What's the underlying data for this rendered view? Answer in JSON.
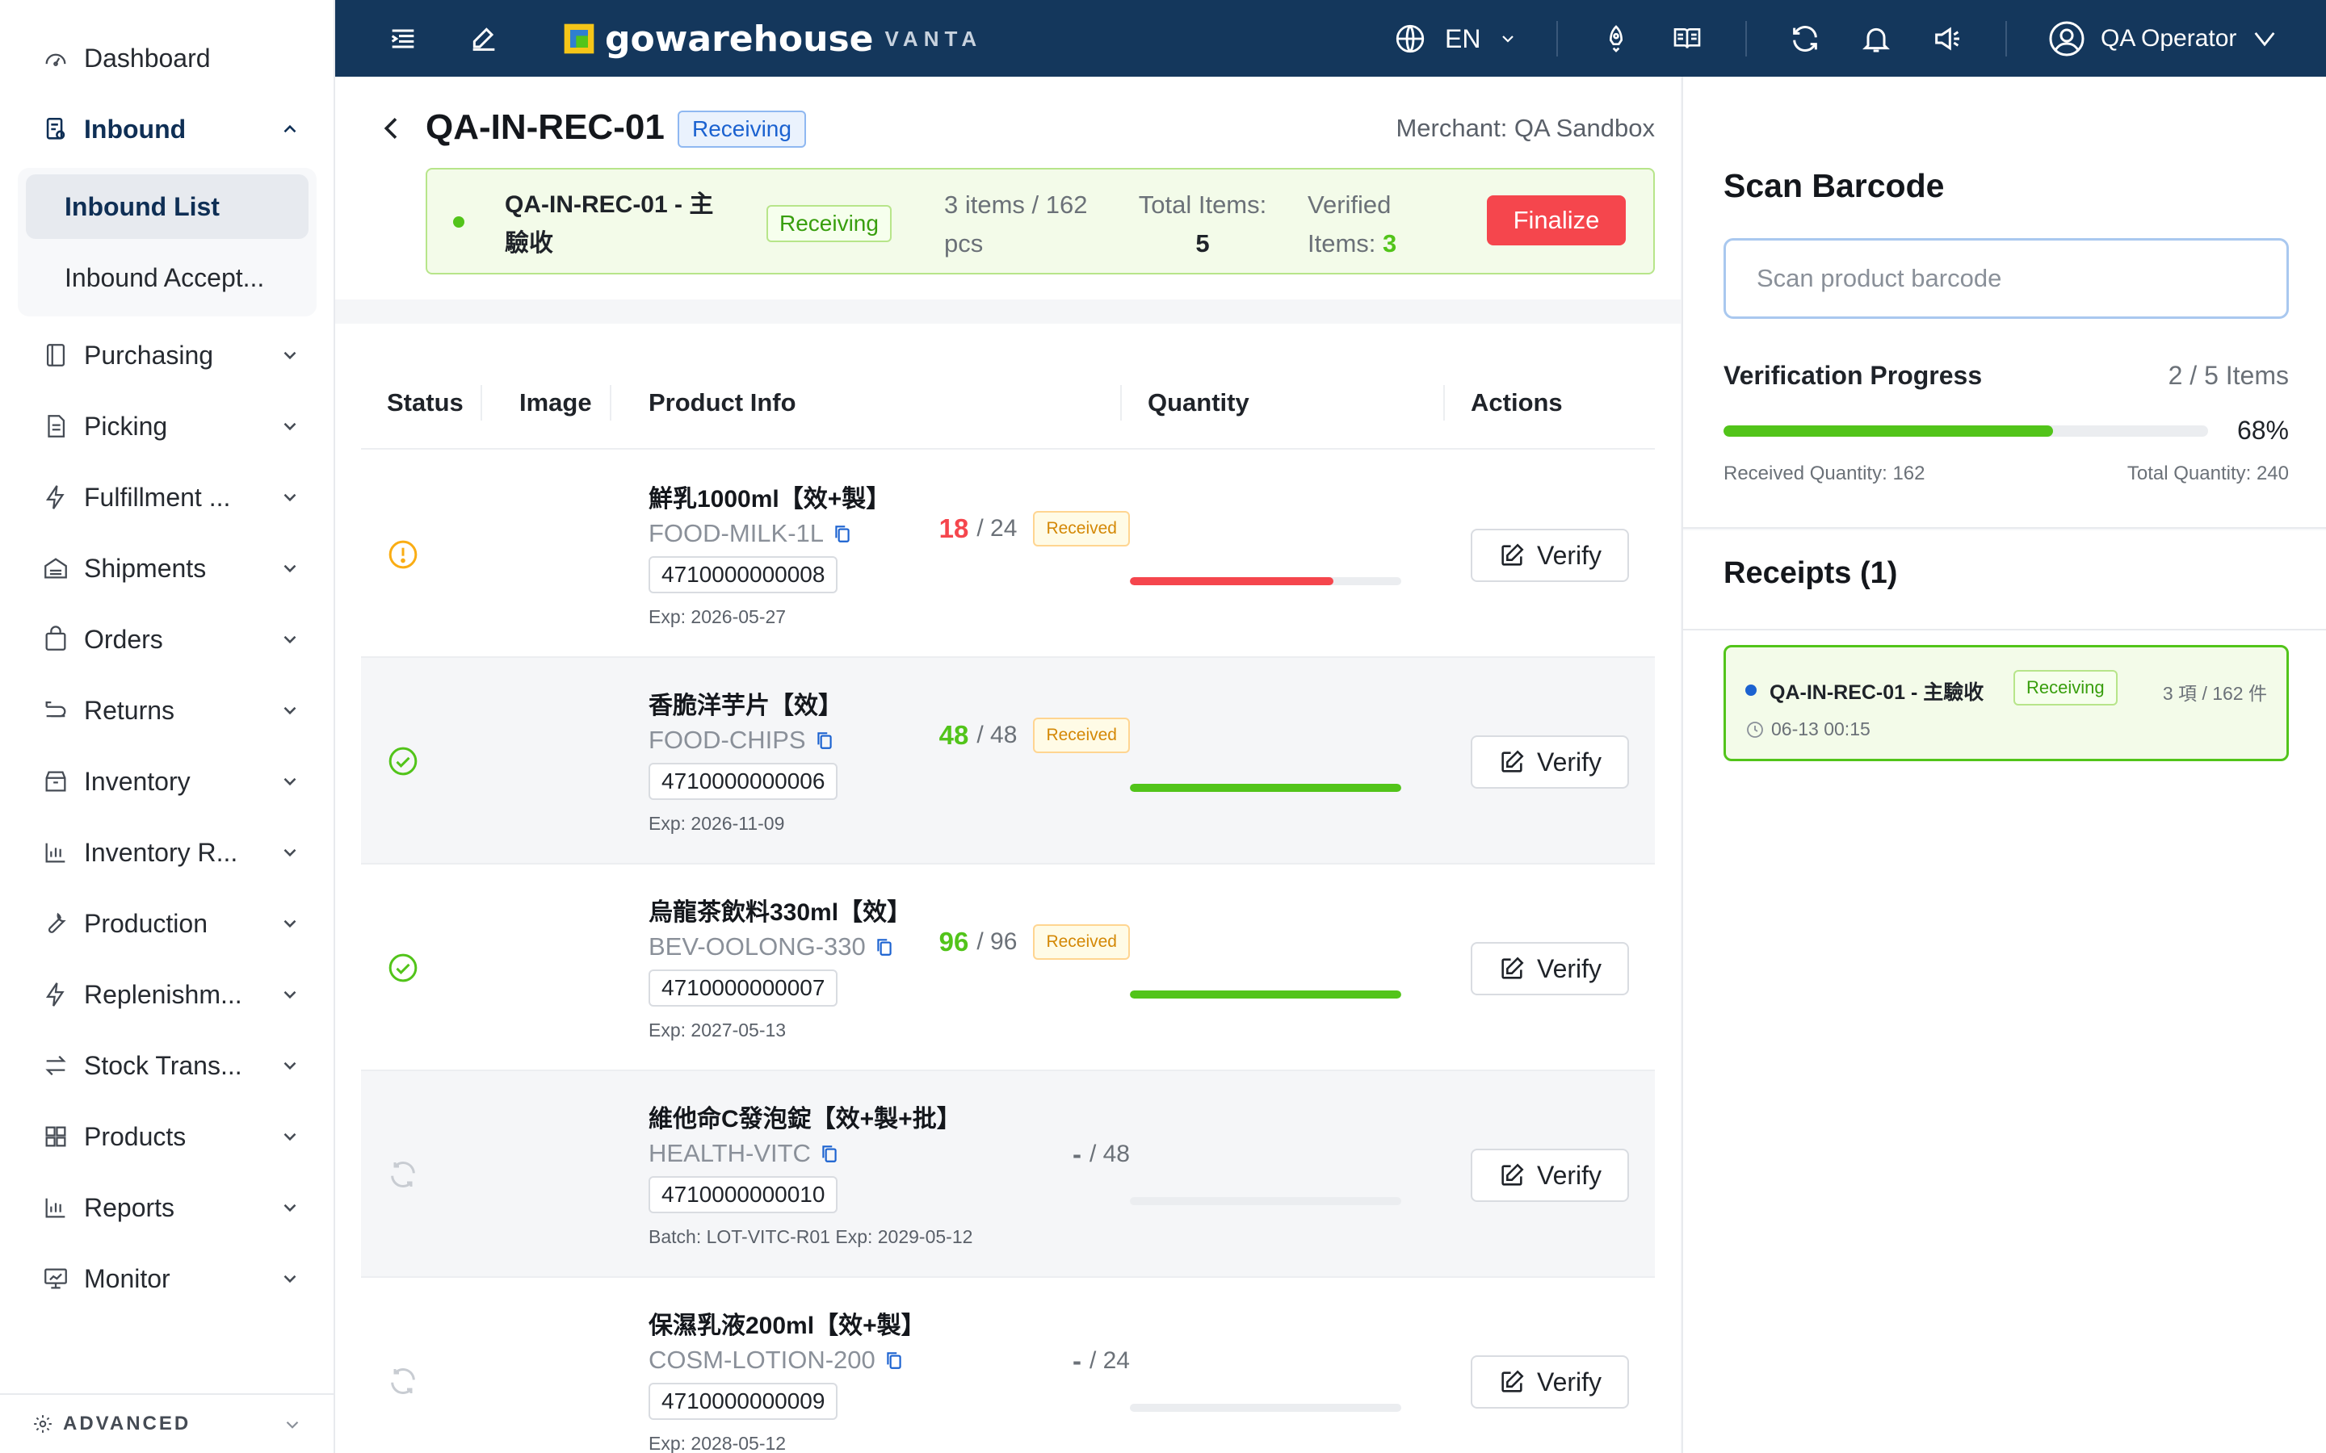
{
  "sidebar": {
    "items": [
      {
        "label": "Dashboard",
        "icon": "dashboard-icon"
      },
      {
        "label": "Inbound",
        "icon": "inbound-icon"
      },
      {
        "label": "Purchasing",
        "icon": "purchasing-icon"
      },
      {
        "label": "Picking",
        "icon": "picking-icon"
      },
      {
        "label": "Fulfillment ...",
        "icon": "fulfillment-icon"
      },
      {
        "label": "Shipments",
        "icon": "shipments-icon"
      },
      {
        "label": "Orders",
        "icon": "orders-icon"
      },
      {
        "label": "Returns",
        "icon": "returns-icon"
      },
      {
        "label": "Inventory",
        "icon": "inventory-icon"
      },
      {
        "label": "Inventory R...",
        "icon": "inventory-report-icon"
      },
      {
        "label": "Production",
        "icon": "production-icon"
      },
      {
        "label": "Replenishm...",
        "icon": "replenishment-icon"
      },
      {
        "label": "Stock Trans...",
        "icon": "stock-transfer-icon"
      },
      {
        "label": "Products",
        "icon": "products-icon"
      },
      {
        "label": "Reports",
        "icon": "reports-icon"
      },
      {
        "label": "Monitor",
        "icon": "monitor-icon"
      }
    ],
    "inbound_sub": {
      "list": "Inbound List",
      "accept": "Inbound Accept..."
    },
    "advanced": "ADVANCED"
  },
  "topbar": {
    "brand": "gowarehouse",
    "brand_suffix": "VANTA",
    "language": "EN",
    "user": "QA Operator"
  },
  "header": {
    "title": "QA-IN-REC-01",
    "status_tag": "Receiving",
    "merchant": "Merchant: QA Sandbox"
  },
  "summary": {
    "name": "QA-IN-REC-01 - 主驗收",
    "tag": "Receiving",
    "count": "3 items / 162 pcs",
    "total_label": "Total Items:",
    "total_value": "5",
    "verified_label": "Verified Items:",
    "verified_value": "3",
    "finalize": "Finalize"
  },
  "table": {
    "headers": {
      "status": "Status",
      "image": "Image",
      "product": "Product Info",
      "quantity": "Quantity",
      "actions": "Actions"
    },
    "received_tag": "Received",
    "verify_label": "Verify",
    "rows": [
      {
        "status": "warning",
        "name": "鮮乳1000ml【效+製】",
        "sku": "FOOD-MILK-1L",
        "barcode": "4710000000008",
        "meta": "Exp: 2026-05-27",
        "received": "18",
        "expected": "/ 24",
        "progress": 0.75,
        "state": "red"
      },
      {
        "status": "ok",
        "name": "香脆洋芋片【效】",
        "sku": "FOOD-CHIPS",
        "barcode": "4710000000006",
        "meta": "Exp: 2026-11-09",
        "received": "48",
        "expected": "/ 48",
        "progress": 1.0,
        "state": "green"
      },
      {
        "status": "ok",
        "name": "烏龍茶飲料330ml【效】",
        "sku": "BEV-OOLONG-330",
        "barcode": "4710000000007",
        "meta": "Exp: 2027-05-13",
        "received": "96",
        "expected": "/ 96",
        "progress": 1.0,
        "state": "green"
      },
      {
        "status": "pending",
        "name": "維他命C發泡錠【效+製+批】",
        "sku": "HEALTH-VITC",
        "barcode": "4710000000010",
        "meta": "Batch: LOT-VITC-R01   Exp: 2029-05-12",
        "received": "-",
        "expected": "/ 48",
        "progress": 0,
        "state": "none"
      },
      {
        "status": "pending",
        "name": "保濕乳液200ml【效+製】",
        "sku": "COSM-LOTION-200",
        "barcode": "4710000000009",
        "meta": "Exp: 2028-05-12",
        "received": "-",
        "expected": "/ 24",
        "progress": 0,
        "state": "none"
      }
    ]
  },
  "scan": {
    "title": "Scan Barcode",
    "placeholder": "Scan product barcode",
    "progress_title": "Verification Progress",
    "progress_count": "2 / 5 Items",
    "progress": 0.68,
    "progress_pct": "68%",
    "received_qty": "Received Quantity: 162",
    "total_qty": "Total Quantity: 240"
  },
  "receipts": {
    "title": "Receipts (1)",
    "items": [
      {
        "name": "QA-IN-REC-01 - 主驗收",
        "tag": "Receiving",
        "count": "3 項 / 162 件",
        "time": "06-13 00:15"
      }
    ]
  },
  "colors": {
    "topbar": "#14375c",
    "accent_blue": "#1b62d0",
    "success": "#52c41a",
    "danger": "#f5464d",
    "warning": "#faad14"
  }
}
